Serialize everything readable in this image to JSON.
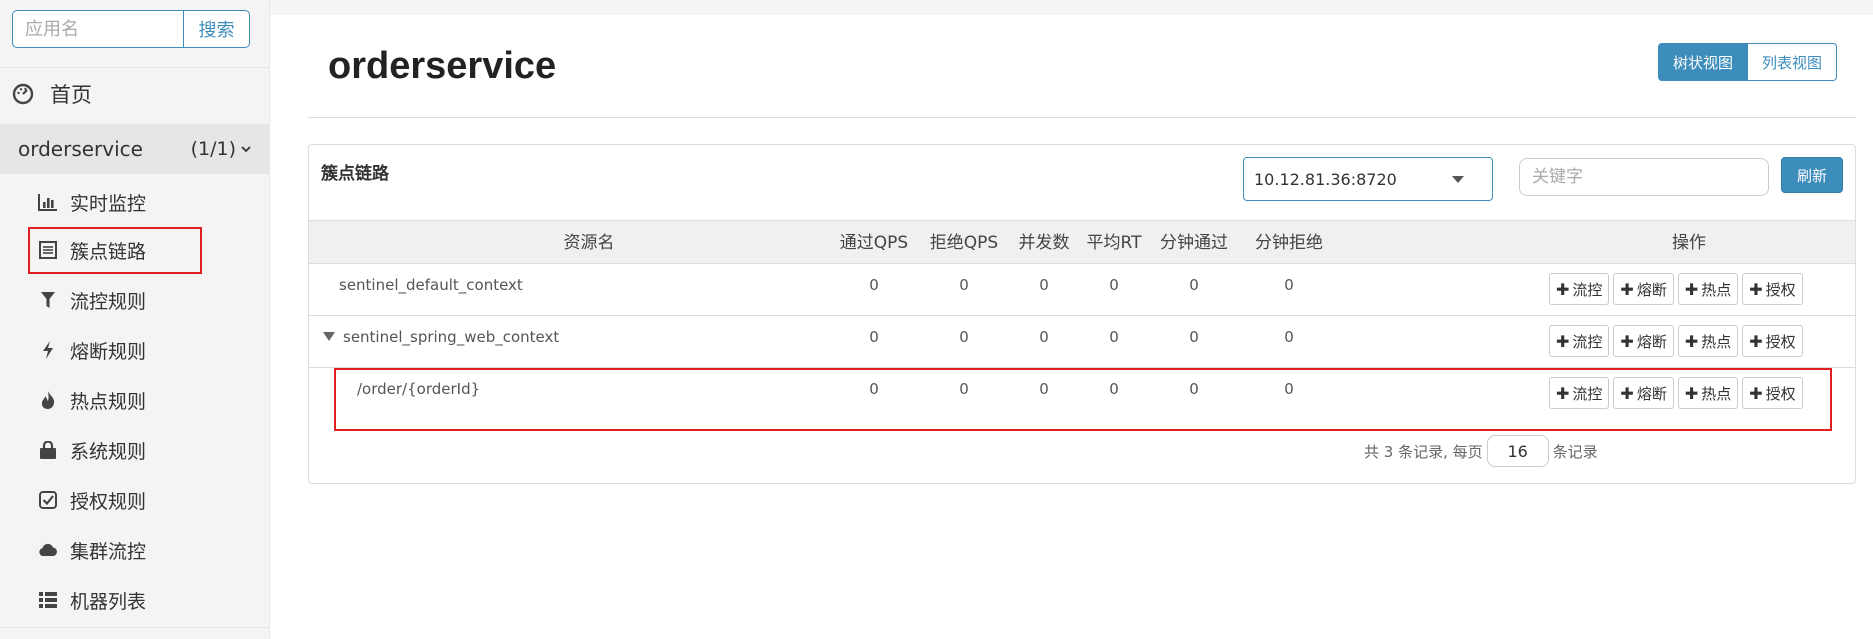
{
  "sidebar": {
    "search": {
      "placeholder": "应用名",
      "button": "搜索"
    },
    "home": {
      "label": "首页",
      "icon": "dashboard-icon"
    },
    "app": {
      "name": "orderservice",
      "count": "(1/1)",
      "icon": "chevron-down-icon"
    },
    "items": [
      {
        "label": "实时监控",
        "icon": "bar-chart-icon"
      },
      {
        "label": "簇点链路",
        "icon": "list-icon"
      },
      {
        "label": "流控规则",
        "icon": "filter-icon"
      },
      {
        "label": "熔断规则",
        "icon": "bolt-icon"
      },
      {
        "label": "热点规则",
        "icon": "fire-icon"
      },
      {
        "label": "系统规则",
        "icon": "lock-icon"
      },
      {
        "label": "授权规则",
        "icon": "check-square-icon"
      },
      {
        "label": "集群流控",
        "icon": "cloud-icon"
      },
      {
        "label": "机器列表",
        "icon": "th-list-icon"
      }
    ]
  },
  "main": {
    "title": "orderservice",
    "view_toggle": {
      "tree": "树状视图",
      "list": "列表视图"
    },
    "panel": {
      "title": "簇点链路",
      "machine": "10.12.81.36:8720",
      "keyword_placeholder": "关键字",
      "refresh": "刷新"
    },
    "table": {
      "headers": [
        "资源名",
        "通过QPS",
        "拒绝QPS",
        "并发数",
        "平均RT",
        "分钟通过",
        "分钟拒绝",
        "操作"
      ],
      "rows": [
        {
          "name": "sentinel_default_context",
          "values": [
            "0",
            "0",
            "0",
            "0",
            "0",
            "0"
          ],
          "expandable": false
        },
        {
          "name": "sentinel_spring_web_context",
          "values": [
            "0",
            "0",
            "0",
            "0",
            "0",
            "0"
          ],
          "expandable": true
        },
        {
          "name": "/order/{orderId}",
          "values": [
            "0",
            "0",
            "0",
            "0",
            "0",
            "0"
          ],
          "expandable": false
        }
      ],
      "ops": [
        "流控",
        "熔断",
        "热点",
        "授权"
      ]
    },
    "pager": {
      "prefix": "共 3 条记录, 每页",
      "page_size": "16",
      "suffix": "条记录"
    }
  },
  "colors": {
    "accent": "#3c8dbc",
    "highlight": "#e02020"
  }
}
